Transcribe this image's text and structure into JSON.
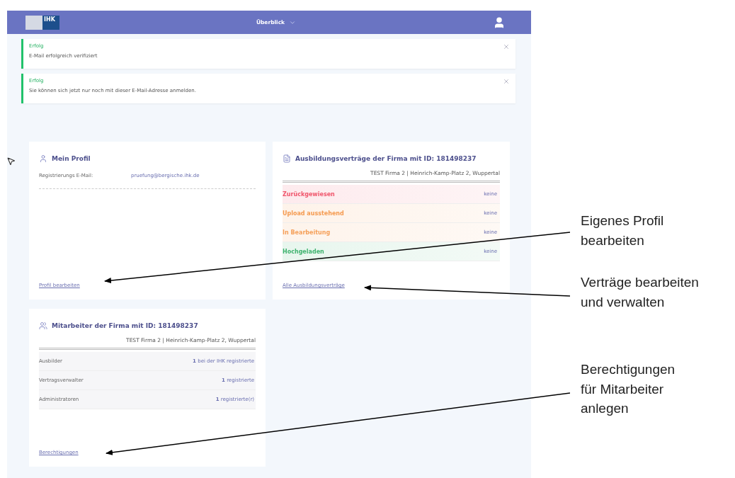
{
  "nav": {
    "logo": "IHK",
    "menu": "Überblick"
  },
  "alerts": [
    {
      "title": "Erfolg",
      "message": "E-Mail erfolgreich verifiziert"
    },
    {
      "title": "Erfolg",
      "message": "Sie können sich jetzt nur noch mit dieser E-Mail-Adresse anmelden."
    }
  ],
  "profile": {
    "title": "Mein Profil",
    "fields": [
      {
        "label": "Registrierungs E-Mail:",
        "value": "pruefung@bergische.ihk.de"
      }
    ],
    "link": "Profil bearbeiten"
  },
  "contracts": {
    "title": "Ausbildungsverträge der Firma mit ID: 181498237",
    "company": "TEST Firma 2 | Heinrich-Kamp-Platz 2, Wuppertal",
    "rows": [
      {
        "label": "Zurückgewiesen",
        "value": "keine",
        "color": "#f0566c"
      },
      {
        "label": "Upload ausstehend",
        "value": "keine",
        "color": "#f59a4f"
      },
      {
        "label": "In Bearbeitung",
        "value": "keine",
        "color": "#f5a05a"
      },
      {
        "label": "Hochgeladen",
        "value": "keine",
        "color": "#3fb36f"
      }
    ],
    "link": "Alle Ausbildungsverträge"
  },
  "staff": {
    "title": "Mitarbeiter der Firma mit ID: 181498237",
    "company": "TEST Firma 2 | Heinrich-Kamp-Platz 2, Wuppertal",
    "rows": [
      {
        "label": "Ausbilder",
        "count": "1",
        "value": "bei der IHK registrierte"
      },
      {
        "label": "Vertragsverwalter",
        "count": "1",
        "value": "registrierte"
      },
      {
        "label": "Administratoren",
        "count": "1",
        "value": "registrierte(r)"
      }
    ],
    "link": "Berechtigungen"
  },
  "annotations": [
    {
      "text": "Eigenes Profil\nbearbeiten"
    },
    {
      "text": "Verträge bearbeiten\nund verwalten"
    },
    {
      "text": "Berechtigungen\nfür Mitarbeiter\nanlegen"
    }
  ]
}
